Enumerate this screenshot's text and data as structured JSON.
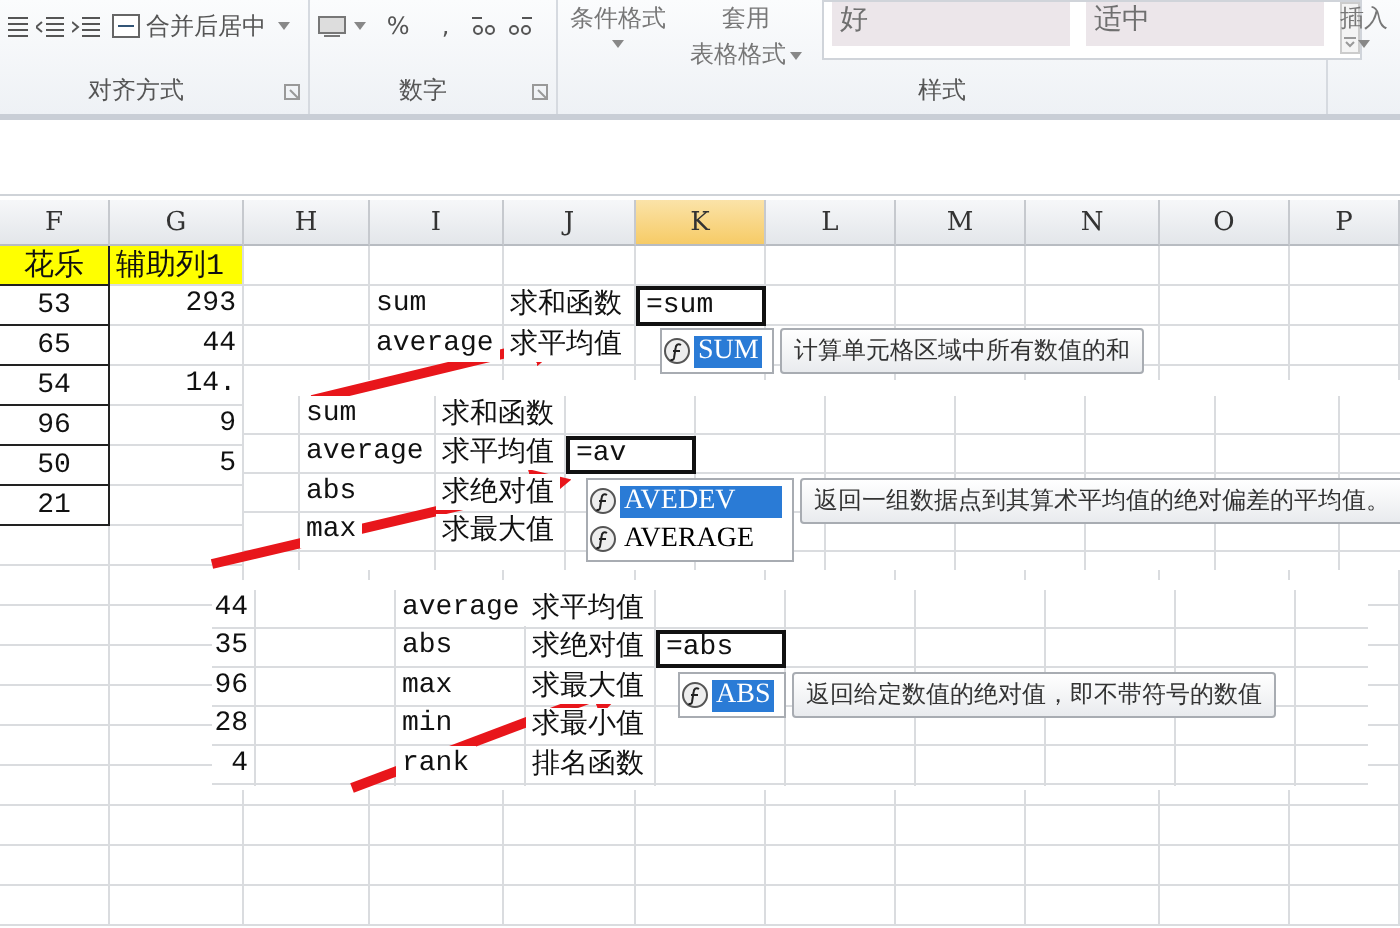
{
  "ribbon": {
    "merge_button": "合并后居中",
    "alignment_label": "对齐方式",
    "percent": "%",
    "comma": ",",
    "number_label": "数字",
    "conditional_format": "条件格式",
    "table_format_top": "套用",
    "table_format_bottom": "表格格式",
    "cell_styles": [
      {
        "label": "好"
      },
      {
        "label": "适中"
      }
    ],
    "styles_label": "样式",
    "insert": "插入"
  },
  "sheet": {
    "columns": [
      {
        "label": "F",
        "selected": false
      },
      {
        "label": "G",
        "selected": false
      },
      {
        "label": "H",
        "selected": false
      },
      {
        "label": "I",
        "selected": false
      },
      {
        "label": "J",
        "selected": false
      },
      {
        "label": "K",
        "selected": true
      },
      {
        "label": "L",
        "selected": false
      },
      {
        "label": "M",
        "selected": false
      },
      {
        "label": "N",
        "selected": false
      },
      {
        "label": "O",
        "selected": false
      },
      {
        "label": "P",
        "selected": false
      }
    ],
    "rows": [
      {
        "kind": "header",
        "F": "花乐",
        "G": "辅助列1"
      },
      {
        "kind": "data",
        "F": "53",
        "G": "293",
        "I": "sum",
        "J": "求和函数",
        "input": "=sum"
      },
      {
        "kind": "data",
        "F": "65",
        "G": "44",
        "I": "average",
        "J": "求平均值"
      },
      {
        "kind": "data",
        "F": "54",
        "G": "14."
      },
      {
        "kind": "data",
        "F": "96",
        "G": "9"
      },
      {
        "kind": "data",
        "F": "50",
        "G": "5"
      },
      {
        "kind": "data",
        "F": "21"
      }
    ],
    "autocomplete": {
      "items": [
        {
          "label": "SUM",
          "selected": true
        }
      ],
      "tooltip": "计算单元格区域中所有数值的和"
    }
  },
  "snippets": [
    {
      "rows": [
        {
          "kind": "data",
          "I": "sum",
          "J": "求和函数"
        },
        {
          "kind": "data",
          "I": "average",
          "J": "求平均值",
          "input": "=av"
        },
        {
          "kind": "data",
          "I": "abs",
          "J": "求绝对值"
        },
        {
          "kind": "data",
          "I": "max",
          "J": "求最大值"
        }
      ],
      "autocomplete": {
        "items": [
          {
            "label": "AVEDEV",
            "selected": true
          },
          {
            "label": "AVERAGE",
            "selected": false
          }
        ],
        "tooltip": "返回一组数据点到其算术平均值的绝对偏差的平均值。"
      }
    },
    {
      "rows": [
        {
          "kind": "data",
          "G": "44",
          "I": "average",
          "J": "求平均值"
        },
        {
          "kind": "data",
          "G": "35",
          "I": "abs",
          "J": "求绝对值",
          "input": "=abs"
        },
        {
          "kind": "data",
          "G": "96",
          "I": "max",
          "J": "求最大值"
        },
        {
          "kind": "data",
          "G": "28",
          "I": "min",
          "J": "求最小值"
        },
        {
          "kind": "data",
          "G": "4",
          "I": "rank",
          "J": "排名函数"
        }
      ],
      "autocomplete": {
        "items": [
          {
            "label": "ABS",
            "selected": true
          }
        ],
        "tooltip": "返回给定数值的绝对值，即不带符号的数值"
      }
    }
  ]
}
